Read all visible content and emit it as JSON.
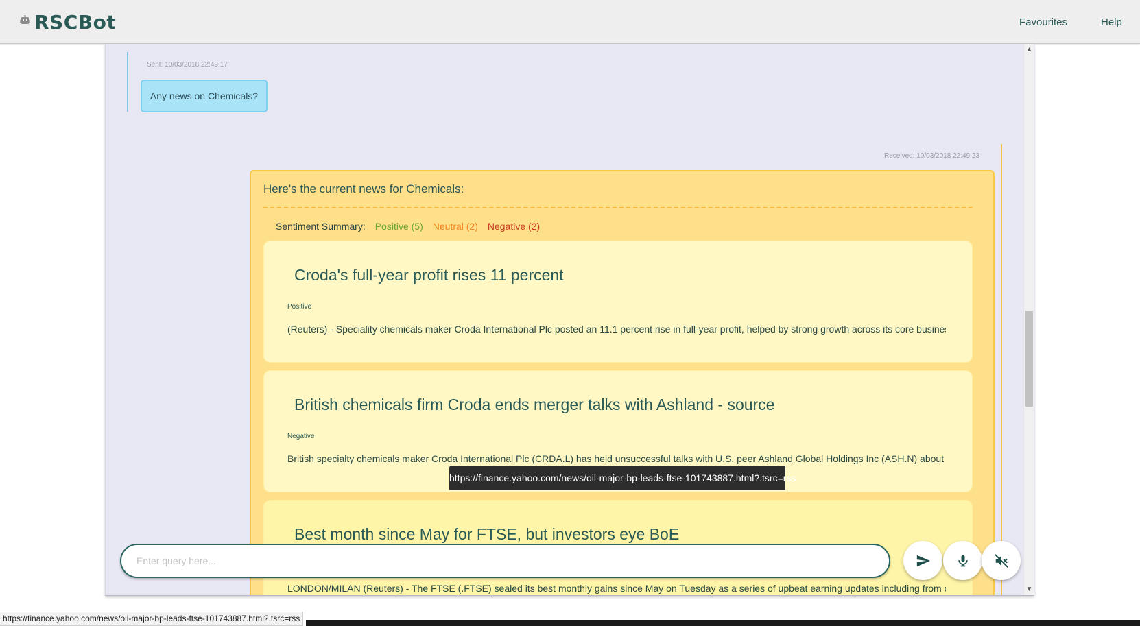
{
  "app": {
    "brand": "RSCBot"
  },
  "nav": {
    "favourites": "Favourites",
    "help": "Help"
  },
  "sent": {
    "timestamp": "Sent: 10/03/2018 22:49:17",
    "text": "Any news on Chemicals?"
  },
  "received": {
    "timestamp": "Received: 10/03/2018 22:49:23",
    "intro": "Here's the current news for Chemicals:",
    "sentiment": {
      "label": "Sentiment Summary:",
      "positive": "Positive (5)",
      "neutral": "Neutral (2)",
      "negative": "Negative (2)"
    },
    "news": [
      {
        "title": "Croda's full-year profit rises 11 percent",
        "sentiment": "Positive",
        "snippet": "(Reuters) - Speciality chemicals maker Croda International Plc posted an 11.1 percent rise in full-year profit, helped by strong growth across its core businesses. Croda..."
      },
      {
        "title": "British chemicals firm Croda ends merger talks with Ashland - source",
        "sentiment": "Negative",
        "snippet": "British specialty chemicals maker Croda International Plc (CRDA.L) has held unsuccessful talks with U.S. peer Ashland Global Holdings Inc (ASH.N) about a possible m..."
      },
      {
        "title": "Best month since May for FTSE, but investors eye BoE",
        "sentiment": "",
        "snippet": "LONDON/MILAN (Reuters) - The FTSE (.FTSE) sealed its best monthly gains since May on Tuesday as a series of upbeat earning updates including from oil major BP ..."
      }
    ]
  },
  "tooltip": "https://finance.yahoo.com/news/oil-major-bp-leads-ftse-101743887.html?.tsrc=rss",
  "query": {
    "placeholder": "Enter query here..."
  },
  "status_bar": "https://finance.yahoo.com/news/oil-major-bp-leads-ftse-101743887.html?.tsrc=rss",
  "icons": {
    "send": "send-icon",
    "mic": "microphone-icon",
    "mute": "volume-mute-icon"
  },
  "colors": {
    "accent": "#2a5a55",
    "positive": "#6aa632",
    "neutral": "#f0841c",
    "negative": "#c63d24"
  }
}
